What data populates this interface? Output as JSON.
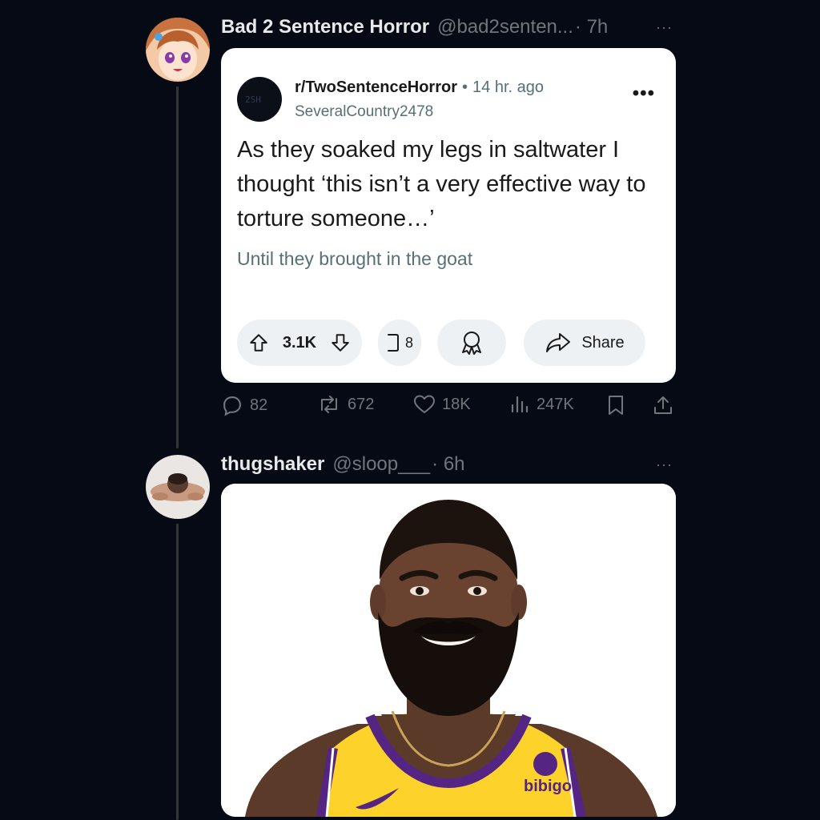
{
  "posts": [
    {
      "display_name": "Bad 2 Sentence Horror",
      "handle": "@bad2senten...",
      "time": "· 7h",
      "more": "···",
      "embed": {
        "subreddit": "r/TwoSentenceHorror",
        "age": "14 hr. ago",
        "dot": "•",
        "user": "SeveralCountry2478",
        "avatar_text": "2SH",
        "title": "As they soaked my legs in saltwater I thought ‘this isn’t a very effective way to torture someone…’",
        "body": "Until they brought in the goat",
        "upvotes": "3.1K",
        "comments": "8",
        "share_label": "Share",
        "more": "•••"
      },
      "stats": {
        "replies": "82",
        "reposts": "672",
        "likes": "18K",
        "views": "247K"
      }
    },
    {
      "display_name": "thugshaker",
      "handle": "@sloop___",
      "time": "· 6h",
      "more": "···",
      "image": {
        "jersey_text": "bibigo"
      }
    }
  ],
  "colors": {
    "background": "#050a14",
    "muted": "#71767b",
    "card": "#ffffff",
    "jersey": "#fdd22b",
    "jersey_trim": "#552583"
  }
}
